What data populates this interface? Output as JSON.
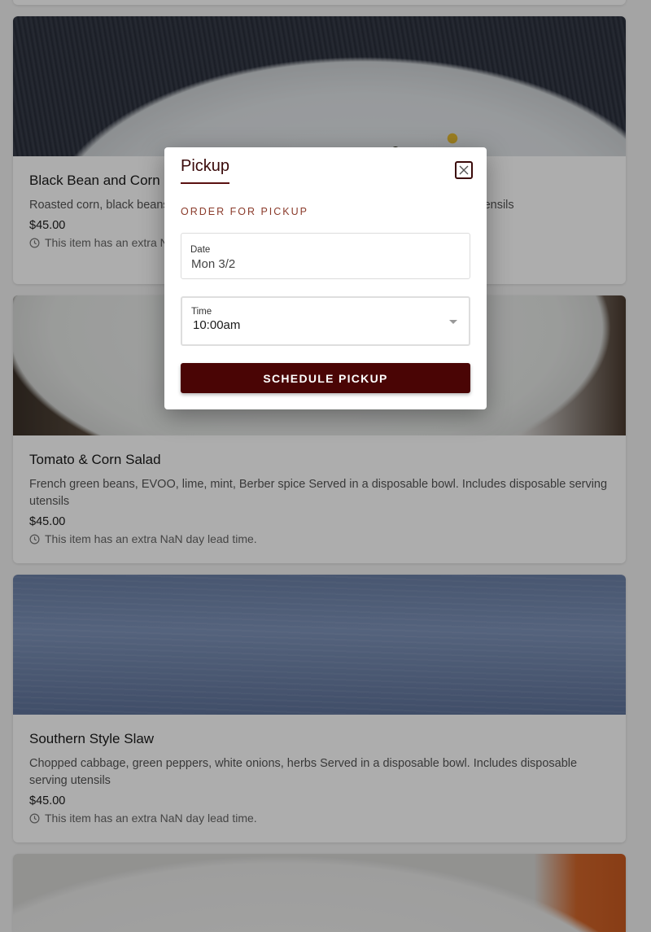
{
  "menu": {
    "items": [
      {
        "title": "Black Bean and Corn",
        "description": "Roasted corn, black beans Served in a disposable bowl. Includes disposable serving utensils",
        "price": "$45.00",
        "lead_time": "This item has an extra NaN day lead time."
      },
      {
        "title": "Tomato & Corn Salad",
        "description": "French green beans, EVOO, lime, mint, Berber spice Served in a disposable bowl. Includes disposable serving utensils",
        "price": "$45.00",
        "lead_time": "This item has an extra NaN day lead time."
      },
      {
        "title": "Southern Style Slaw",
        "description": "Chopped cabbage, green peppers, white onions, herbs Served in a disposable bowl. Includes disposable serving utensils",
        "price": "$45.00",
        "lead_time": "This item has an extra NaN day lead time."
      }
    ]
  },
  "modal": {
    "tab_label": "Pickup",
    "section_label": "ORDER FOR PICKUP",
    "date": {
      "label": "Date",
      "value": "Mon 3/2"
    },
    "time": {
      "label": "Time",
      "value": "10:00am"
    },
    "submit_label": "SCHEDULE PICKUP"
  },
  "icons": {
    "close": "close-icon",
    "clock": "clock-icon",
    "caret": "chevron-down-icon"
  },
  "colors": {
    "accent": "#4a0505",
    "section_label": "#8a3a2a",
    "overlay": "rgba(0,0,0,0.32)"
  }
}
